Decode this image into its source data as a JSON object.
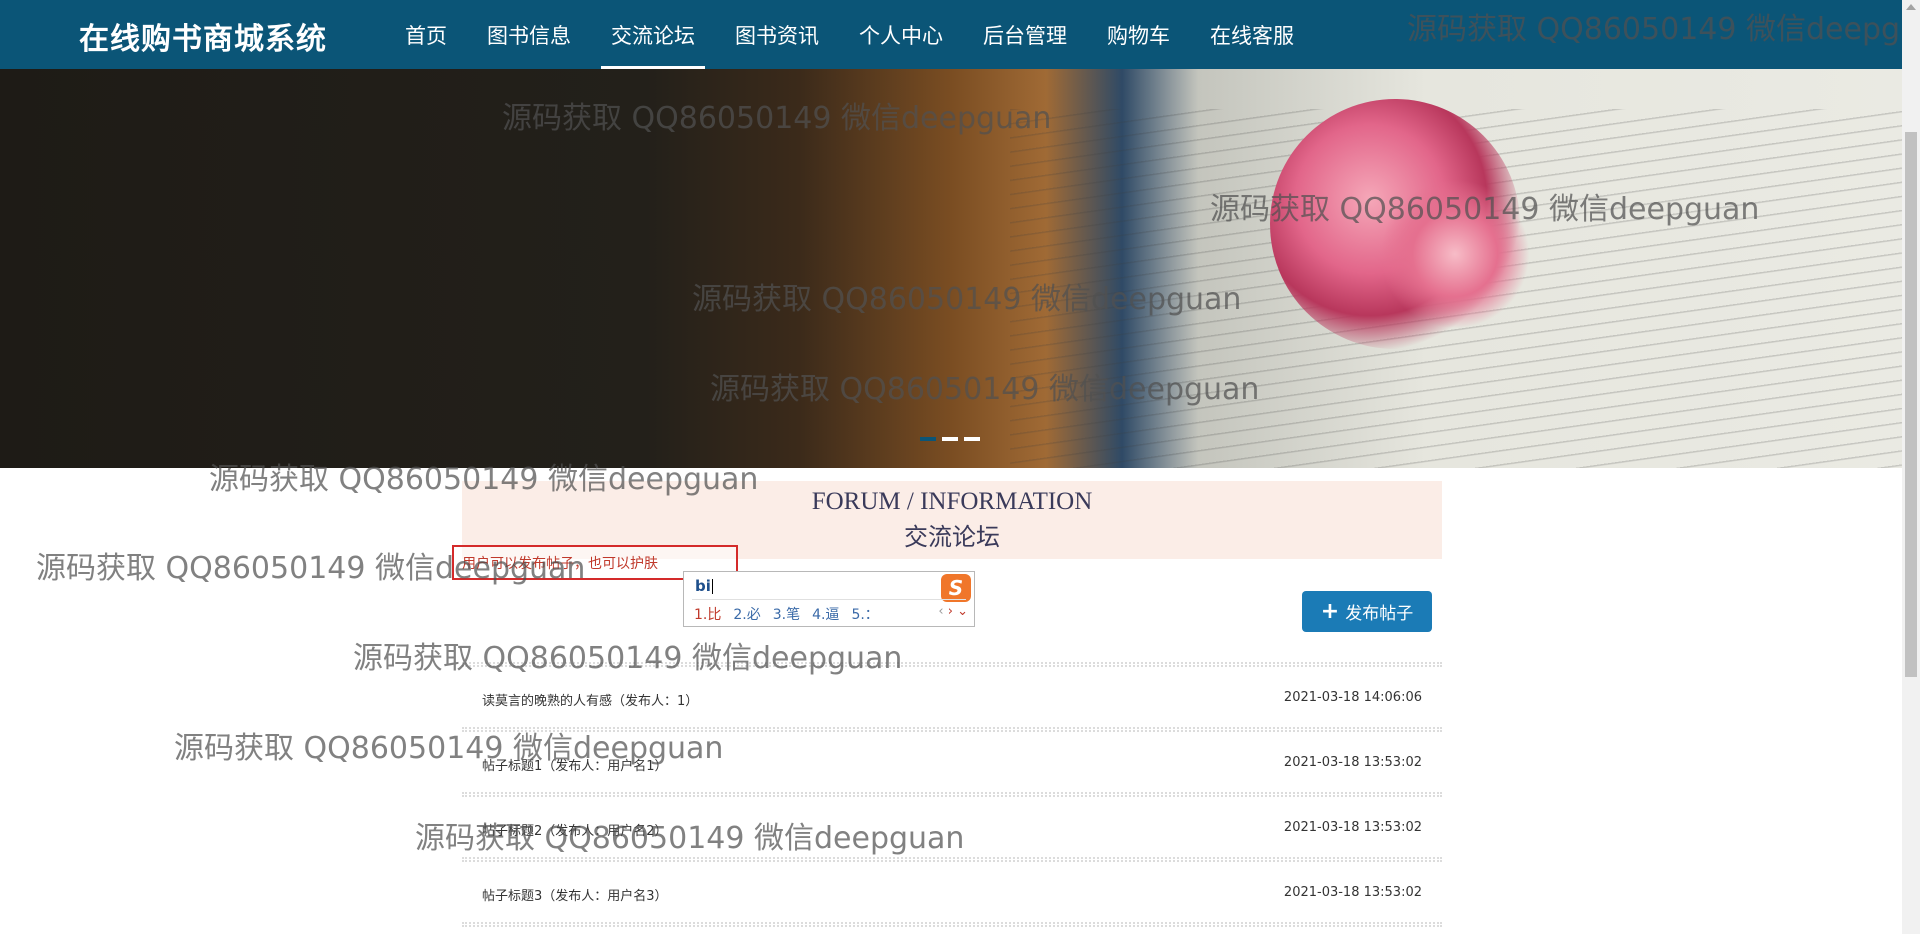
{
  "app": {
    "brand": "在线购书商城系统"
  },
  "nav": [
    {
      "label": "首页",
      "active": false
    },
    {
      "label": "图书信息",
      "active": false
    },
    {
      "label": "交流论坛",
      "active": true
    },
    {
      "label": "图书资讯",
      "active": false
    },
    {
      "label": "个人中心",
      "active": false
    },
    {
      "label": "后台管理",
      "active": false
    },
    {
      "label": "购物车",
      "active": false
    },
    {
      "label": "在线客服",
      "active": false
    }
  ],
  "banner": {
    "slides": 3,
    "active_slide": 1
  },
  "watermark": "源码获取 QQ86050149 微信deepguan",
  "section": {
    "title_en": "FORUM / INFORMATION",
    "title_cn": "交流论坛"
  },
  "note": "用户可以发布帖子，也可以护肤",
  "ime": {
    "input": "bi",
    "logo": "S",
    "candidates": [
      "1.比",
      "2.必",
      "3.笔",
      "4.逼",
      "5.："
    ],
    "arrow_prev": "‹",
    "arrow_next": "›",
    "expand": "⌄"
  },
  "publish_button": {
    "icon": "plus-icon",
    "label": "发布帖子"
  },
  "posts": [
    {
      "title": "读莫言的晚熟的人有感（发布人：1）",
      "date": "2021-03-18 14:06:06"
    },
    {
      "title": "帖子标题1（发布人：用户名1）",
      "date": "2021-03-18 13:53:02"
    },
    {
      "title": "帖子标题2（发布人：用户名2）",
      "date": "2021-03-18 13:53:02"
    },
    {
      "title": "帖子标题3（发布人：用户名3）",
      "date": "2021-03-18 13:53:02"
    }
  ],
  "colors": {
    "header": "#0b5577",
    "accent": "#1b7bb6",
    "panel": "#fbede7",
    "note_border": "#d42a2a"
  }
}
